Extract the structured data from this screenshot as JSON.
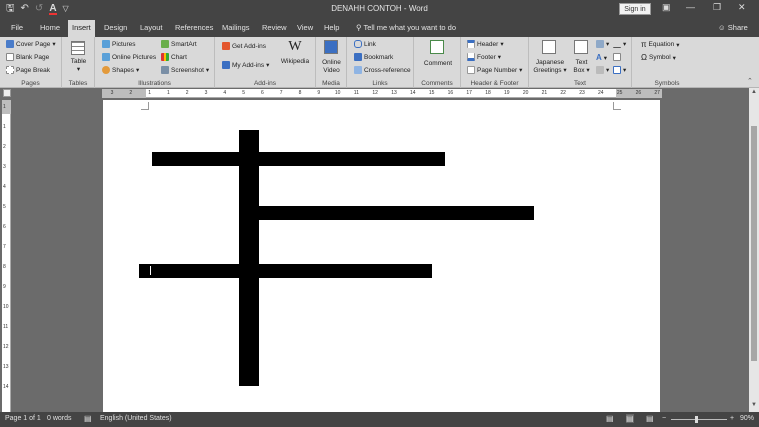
{
  "window": {
    "title": "DENAHH CONTOH  -  Word",
    "sign_in": "Sign in",
    "minimize_glyph": "▭",
    "restore_glyph": "❐",
    "close_glyph": "✕"
  },
  "qat": {
    "save_icon": "save-icon",
    "undo_icon": "undo-icon",
    "redo_icon": "redo-icon",
    "font_color_icon": "font-color-icon",
    "customize_icon": "customize-icon"
  },
  "tabs": [
    "File",
    "Home",
    "Insert",
    "Design",
    "Layout",
    "References",
    "Mailings",
    "Review",
    "View",
    "Help"
  ],
  "active_tab": "Insert",
  "tell_me": "Tell me what you want to do",
  "share": "Share",
  "ribbon": {
    "pages": {
      "items": [
        "Cover Page",
        "Blank Page",
        "Page Break"
      ],
      "label": "Pages"
    },
    "tables": {
      "table": "Table",
      "label": "Tables"
    },
    "illustrations": {
      "items_left": [
        "Pictures",
        "Online Pictures",
        "Shapes"
      ],
      "items_right": [
        "SmartArt",
        "Chart",
        "Screenshot"
      ],
      "label": "Illustrations"
    },
    "addins": {
      "get": "Get Add-ins",
      "my": "My Add-ins",
      "wiki_glyph": "W",
      "wikipedia": "Wikipedia",
      "label": "Add-ins"
    },
    "media": {
      "online_video_1": "Online",
      "online_video_2": "Video",
      "label": "Media"
    },
    "links": {
      "items": [
        "Link",
        "Bookmark",
        "Cross-reference"
      ],
      "label": "Links"
    },
    "comments": {
      "comment": "Comment",
      "label": "Comments"
    },
    "header_footer": {
      "items": [
        "Header",
        "Footer",
        "Page Number"
      ],
      "label": "Header & Footer"
    },
    "text": {
      "japanese_1": "Japanese",
      "japanese_2": "Greetings",
      "textbox_1": "Text",
      "textbox_2": "Box",
      "label": "Text"
    },
    "symbols": {
      "equation": "Equation",
      "symbol": "Symbol",
      "label": "Symbols"
    }
  },
  "ruler_numbers": [
    "3",
    "2",
    "1",
    "1",
    "2",
    "3",
    "4",
    "5",
    "6",
    "7",
    "8",
    "9",
    "10",
    "11",
    "12",
    "13",
    "14",
    "15",
    "16",
    "17",
    "18",
    "19",
    "20",
    "21",
    "22",
    "23",
    "24",
    "25",
    "26",
    "27"
  ],
  "vruler_numbers": [
    "1",
    "1",
    "2",
    "3",
    "4",
    "5",
    "6",
    "7",
    "8",
    "9",
    "10",
    "11",
    "12",
    "13",
    "14"
  ],
  "status": {
    "page": "Page 1 of 1",
    "words": "0 words",
    "language": "English (United States)",
    "zoom": "90%",
    "zoom_level": 0.9
  }
}
